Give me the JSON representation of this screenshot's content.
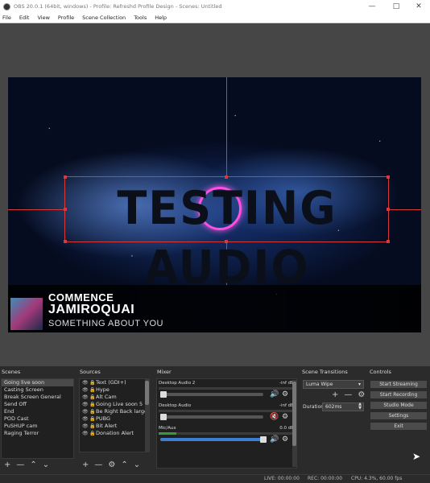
{
  "window": {
    "title": "OBS 20.0.1 (64bit, windows) - Profile: Refreshd Profile Design - Scenes: Untitled"
  },
  "menu": [
    "File",
    "Edit",
    "View",
    "Profile",
    "Scene Collection",
    "Tools",
    "Help"
  ],
  "canvas": {
    "headline": "TESTING AUDIO",
    "now_playing": {
      "label": "COMMENCE",
      "artist": "JAMIROQUAI",
      "track": "SOMETHING ABOUT YOU"
    }
  },
  "scenes": {
    "header": "Scenes",
    "items": [
      "Going live soon",
      "Casting Screen",
      "Break Screen General",
      "Send Off",
      "End",
      "POD Cast",
      "PuSHUP cam",
      "Raging Terror"
    ],
    "selected": 0
  },
  "sources": {
    "header": "Sources",
    "items": [
      "Text (GDI+)",
      "Hype",
      "Alt Cam",
      "Going Live soon 5",
      "Be Right Back large",
      "PUBG",
      "Bit Alert",
      "Donation Alert"
    ]
  },
  "mixer": {
    "header": "Mixer",
    "channels": [
      {
        "name": "Desktop Audio 2",
        "db": "-inf dB",
        "level": 0.0,
        "muted": false
      },
      {
        "name": "Desktop Audio",
        "db": "-inf dB",
        "level": 0.0,
        "muted": true
      },
      {
        "name": "Mic/Aux",
        "db": "0.0 dB",
        "level": 1.0,
        "muted": false
      }
    ]
  },
  "transitions": {
    "header": "Scene Transitions",
    "selected": "Luma Wipe",
    "duration_label": "Duration",
    "duration_value": "602ms"
  },
  "controls": {
    "header": "Controls",
    "buttons": [
      "Start Streaming",
      "Start Recording",
      "Studio Mode",
      "Settings",
      "Exit"
    ]
  },
  "status": {
    "live": "LIVE: 00:00:00",
    "rec": "REC: 00:00:00",
    "cpu": "CPU: 4.3%, 60.00 fps"
  },
  "colors": {
    "selection": "#d63a3a",
    "ring": "#ff4fe0",
    "meter_green": "#3a9a3a",
    "slider_blue": "#3c7fd0"
  }
}
